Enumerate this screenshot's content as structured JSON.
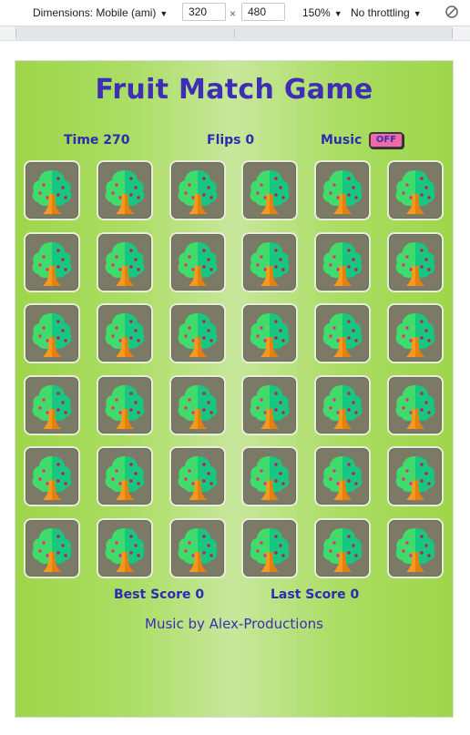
{
  "devtools": {
    "device_label": "Dimensions: Mobile (ami)",
    "width": "320",
    "times": "×",
    "height": "480",
    "zoom": "150%",
    "throttle": "No throttling",
    "caret": "▼",
    "rotate_icon": "rotate-icon"
  },
  "game": {
    "title": "Fruit Match Game",
    "time_label": "Time 270",
    "flips_label": "Flips 0",
    "music_label": "Music",
    "music_toggle": "OFF",
    "best_score": "Best Score 0",
    "last_score": "Last Score 0",
    "credit": "Music by Alex-Productions",
    "rows": 6,
    "cols": 6,
    "card_back_icon": "tree-icon",
    "colors": {
      "title": "#3d2fb5",
      "text": "#2e2bb0",
      "toggle_bg": "#f06aa8",
      "card_bg": "#7b7a66",
      "background": "#9ed64a"
    }
  }
}
